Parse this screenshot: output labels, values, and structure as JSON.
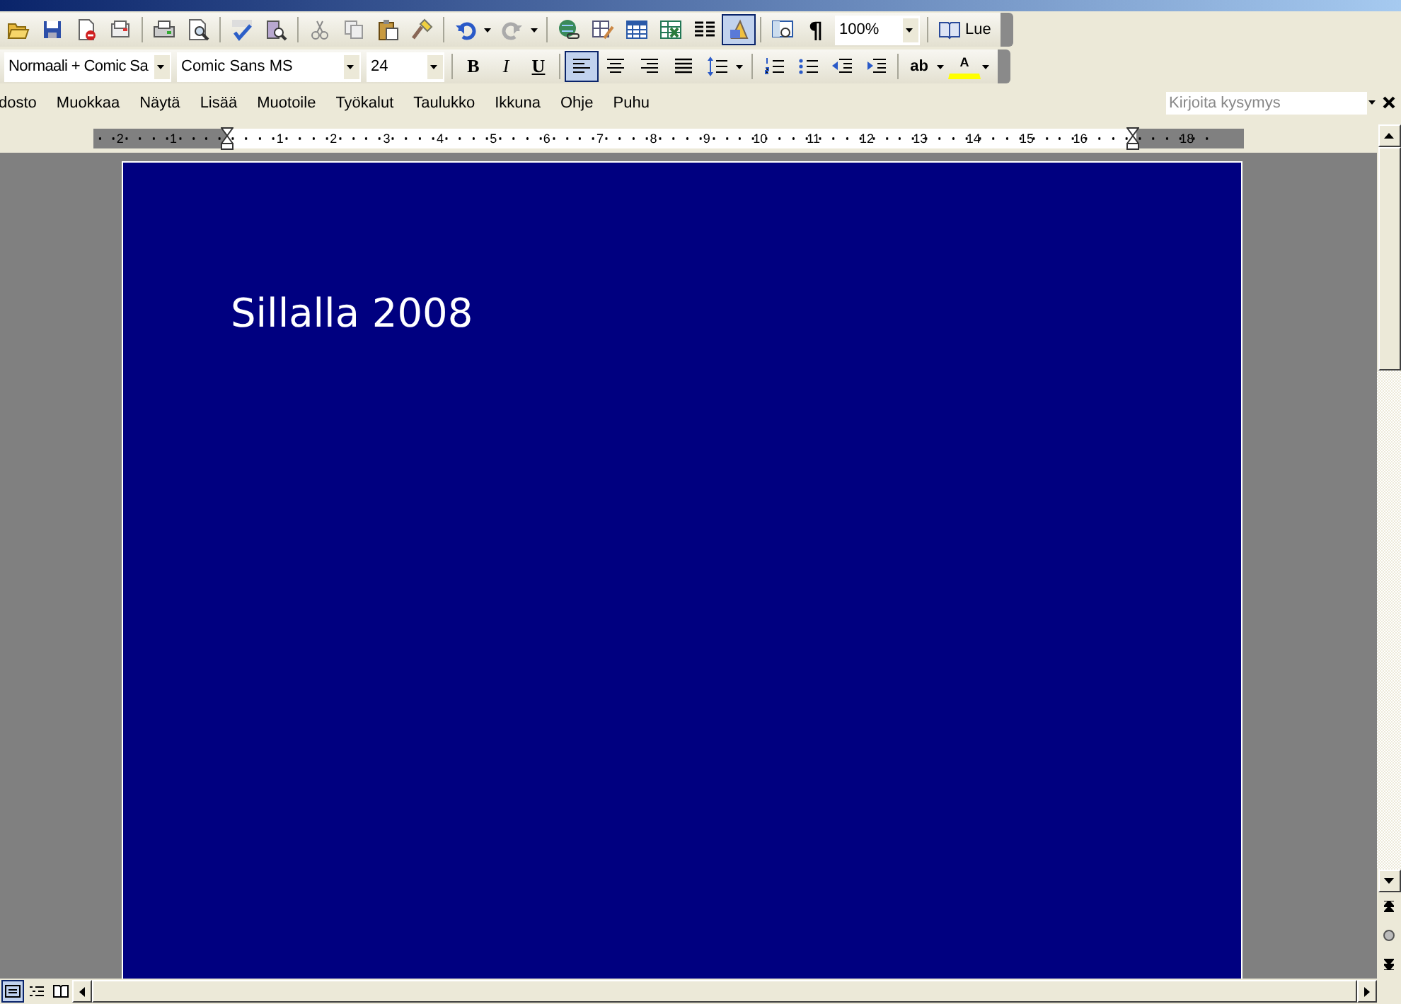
{
  "standard_toolbar": {
    "buttons": [
      {
        "pressed": false
      },
      {
        "pressed": false
      },
      {
        "pressed": false
      },
      {
        "pressed": false
      },
      {
        "pressed": false
      },
      {
        "pressed": false
      },
      {
        "pressed": false
      },
      {
        "pressed": false
      },
      {
        "pressed": false
      },
      {
        "pressed": false
      },
      {
        "pressed": false
      },
      {
        "pressed": false
      },
      {
        "pressed": false
      },
      {
        "pressed": false
      },
      {
        "pressed": false
      },
      {
        "pressed": false
      },
      {
        "pressed": false
      },
      {
        "pressed": false
      },
      {
        "pressed": false
      },
      {
        "pressed": true
      },
      {
        "pressed": false
      }
    ],
    "pilcrow": "¶",
    "zoom": "100%",
    "read_button": "Lue"
  },
  "formatting_toolbar": {
    "style": "Normaali + Comic Sa",
    "font": "Comic Sans MS",
    "size": "24",
    "text_buttons": [
      {
        "label": "B",
        "pressed": false
      },
      {
        "label": "I",
        "pressed": false
      },
      {
        "label": "U",
        "pressed": false
      }
    ],
    "buttons": [
      {
        "pressed": true
      },
      {
        "pressed": false
      },
      {
        "pressed": false
      },
      {
        "pressed": false
      },
      {
        "pressed": false
      },
      {
        "pressed": false
      },
      {
        "pressed": false
      },
      {
        "pressed": false
      },
      {
        "pressed": false
      },
      {
        "pressed": false,
        "label": "ab"
      },
      {
        "pressed": false,
        "label": "A"
      }
    ]
  },
  "menu": [
    "dosto",
    "Muokkaa",
    "Näytä",
    "Lisää",
    "Muotoile",
    "Työkalut",
    "Taulukko",
    "Ikkuna",
    "Ohje",
    "Puhu"
  ],
  "help_field": {
    "placeholder": "Kirjoita kysymys"
  },
  "ruler": {
    "left_labels": [
      "2",
      "1"
    ],
    "body_labels": [
      "1",
      "2",
      "3",
      "4",
      "5",
      "6",
      "7",
      "8",
      "9",
      "10",
      "11",
      "12",
      "13",
      "14",
      "15",
      "16"
    ],
    "right_labels": [
      "18"
    ]
  },
  "document": {
    "heading": "Sillalla 2008"
  },
  "view_buttons": [
    {
      "selected": true
    },
    {
      "selected": false
    },
    {
      "selected": false
    }
  ]
}
